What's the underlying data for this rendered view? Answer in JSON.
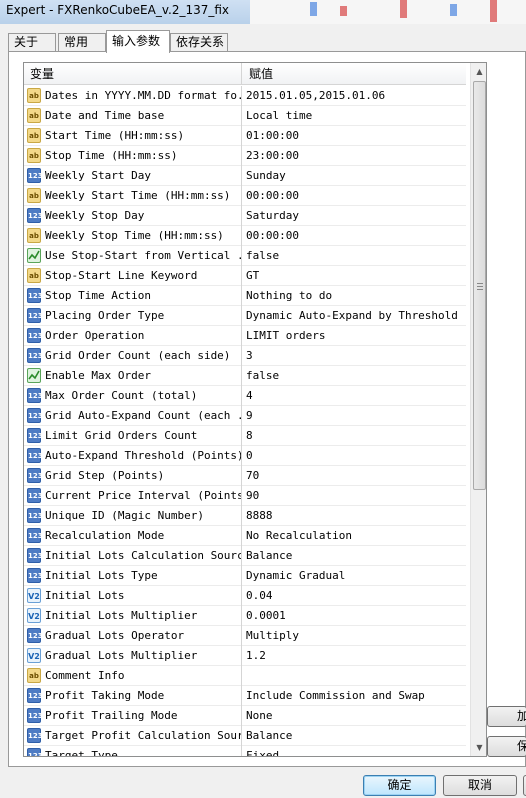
{
  "window": {
    "title": "Expert - FXRenkoCubeEA_v.2_137_fix"
  },
  "tabs": [
    {
      "label": "关于",
      "active": false
    },
    {
      "label": "常用",
      "active": false
    },
    {
      "label": "输入参数",
      "active": true
    },
    {
      "label": "依存关系",
      "active": false
    }
  ],
  "grid": {
    "headers": {
      "variable": "变量",
      "value": "赋值"
    },
    "rows": [
      {
        "icon": "ab",
        "name": "Dates in YYYY.MM.DD format fo...",
        "value": "2015.01.05,2015.01.06"
      },
      {
        "icon": "ab",
        "name": "Date and Time base",
        "value": "Local time"
      },
      {
        "icon": "ab",
        "name": "Start Time (HH:mm:ss)",
        "value": "01:00:00"
      },
      {
        "icon": "ab",
        "name": "Stop Time (HH:mm:ss)",
        "value": "23:00:00"
      },
      {
        "icon": "123",
        "name": "Weekly Start Day",
        "value": "Sunday"
      },
      {
        "icon": "ab",
        "name": "Weekly Start Time (HH:mm:ss)",
        "value": "00:00:00"
      },
      {
        "icon": "123",
        "name": "Weekly Stop Day",
        "value": "Saturday"
      },
      {
        "icon": "ab",
        "name": "Weekly Stop Time (HH:mm:ss)",
        "value": "00:00:00"
      },
      {
        "icon": "bool",
        "name": "Use Stop-Start from Vertical ...",
        "value": "false"
      },
      {
        "icon": "ab",
        "name": "Stop-Start Line Keyword",
        "value": "GT"
      },
      {
        "icon": "123",
        "name": "Stop Time Action",
        "value": "Nothing to do"
      },
      {
        "icon": "123",
        "name": "Placing Order Type",
        "value": "Dynamic Auto-Expand by Threshold"
      },
      {
        "icon": "123",
        "name": "Order Operation",
        "value": "LIMIT orders"
      },
      {
        "icon": "123",
        "name": "Grid Order Count (each side)",
        "value": "3"
      },
      {
        "icon": "bool",
        "name": "Enable Max Order",
        "value": "false"
      },
      {
        "icon": "123",
        "name": "Max Order Count (total)",
        "value": "4"
      },
      {
        "icon": "123",
        "name": "Grid Auto-Expand Count (each ...",
        "value": "9"
      },
      {
        "icon": "123",
        "name": "Limit Grid Orders Count",
        "value": "8"
      },
      {
        "icon": "123",
        "name": "Auto-Expand Threshold (Points)",
        "value": "0"
      },
      {
        "icon": "123",
        "name": "Grid Step (Points)",
        "value": "70"
      },
      {
        "icon": "123",
        "name": "Current Price Interval (Points)",
        "value": "90"
      },
      {
        "icon": "123",
        "name": "Unique ID (Magic Number)",
        "value": "8888"
      },
      {
        "icon": "123",
        "name": "Recalculation Mode",
        "value": "No Recalculation"
      },
      {
        "icon": "123",
        "name": "Initial Lots Calculation Source",
        "value": "Balance"
      },
      {
        "icon": "123",
        "name": "Initial Lots Type",
        "value": "Dynamic Gradual"
      },
      {
        "icon": "dbl",
        "name": "Initial Lots",
        "value": "0.04"
      },
      {
        "icon": "dbl",
        "name": "Initial Lots Multiplier",
        "value": "0.0001"
      },
      {
        "icon": "123",
        "name": "Gradual Lots Operator",
        "value": "Multiply"
      },
      {
        "icon": "dbl",
        "name": "Gradual Lots Multiplier",
        "value": "1.2"
      },
      {
        "icon": "ab",
        "name": "Comment Info",
        "value": ""
      },
      {
        "icon": "123",
        "name": "Profit Taking Mode",
        "value": "Include Commission and Swap"
      },
      {
        "icon": "123",
        "name": "Profit Trailing Mode",
        "value": "None"
      },
      {
        "icon": "123",
        "name": "Target Profit Calculation Source",
        "value": "Balance"
      },
      {
        "icon": "123",
        "name": "Target Type",
        "value": "Fixed"
      }
    ]
  },
  "side_buttons": {
    "load": "加",
    "save": "保"
  },
  "footer": {
    "ok": "确定",
    "cancel": "取消",
    "reset": ""
  },
  "scrollbar": {
    "position": 0.0
  }
}
